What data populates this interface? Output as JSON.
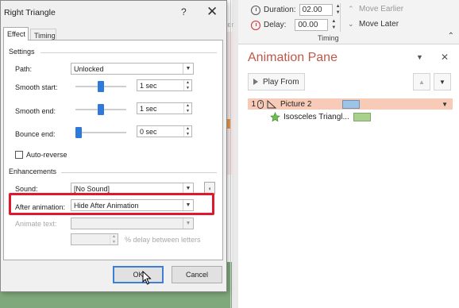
{
  "dialog": {
    "title": "Right Triangle",
    "help_glyph": "?",
    "close_glyph": "✕",
    "tabs": [
      {
        "label": "Effect",
        "active": true
      },
      {
        "label": "Timing",
        "active": false
      }
    ],
    "settings_heading": "Settings",
    "path": {
      "label": "Path:",
      "value": "Unlocked"
    },
    "smooth_start": {
      "label": "Smooth start:",
      "value": "1 sec",
      "level": 0.5
    },
    "smooth_end": {
      "label": "Smooth end:",
      "value": "1 sec",
      "level": 0.5
    },
    "bounce_end": {
      "label": "Bounce end:",
      "value": "0 sec",
      "level": 0.0
    },
    "auto_reverse": {
      "label": "Auto-reverse",
      "checked": false
    },
    "enhancements_heading": "Enhancements",
    "sound": {
      "label": "Sound:",
      "value": "[No Sound]"
    },
    "after_animation": {
      "label": "After animation:",
      "value": "Hide After Animation"
    },
    "animate_text": {
      "label": "Animate text:",
      "value": ""
    },
    "delay_between_letters": {
      "value": "",
      "suffix": "% delay between letters"
    },
    "ok_label": "OK",
    "cancel_label": "Cancel",
    "highlight_color": "#e0182d"
  },
  "ribbon": {
    "duration": {
      "label": "Duration:",
      "value": "02.00"
    },
    "delay": {
      "label": "Delay:",
      "value": "00.00"
    },
    "move_earlier": "Move Earlier",
    "move_later": "Move Later",
    "group_label": "Timing"
  },
  "background": {
    "hint_text": "ter"
  },
  "animation_pane": {
    "title": "Animation Pane",
    "play_from_label": "Play From",
    "accent_color": "#c0574a",
    "items": [
      {
        "number": "1",
        "name": "Picture 2",
        "selected": true,
        "bar_color": "#9dc3e6"
      },
      {
        "number": "",
        "name": "Isosceles Triangl...",
        "selected": false,
        "bar_color": "#a9d18e"
      }
    ]
  }
}
